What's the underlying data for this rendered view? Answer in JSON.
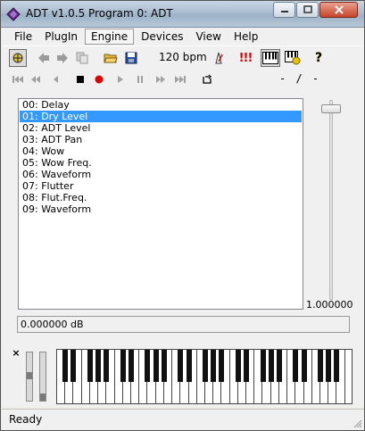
{
  "window": {
    "title": "ADT v1.0.5 Program 0: ADT"
  },
  "menu": [
    "File",
    "PlugIn",
    "Engine",
    "Devices",
    "View",
    "Help"
  ],
  "menu_active": "Engine",
  "toolbar": {
    "bpm": "120 bpm",
    "alert": "!!!",
    "help": "?"
  },
  "transport": {
    "time": "- / -"
  },
  "parameters": [
    "00: Delay",
    "01: Dry Level",
    "02: ADT Level",
    "03: ADT Pan",
    "04: Wow",
    "05: Wow Freq.",
    "06: Waveform",
    "07: Flutter",
    "08: Flut.Freq.",
    "09: Waveform"
  ],
  "selected_parameter": "01: Dry Level",
  "slider": {
    "value": "1.000000"
  },
  "value_field": "0.000000 dB",
  "keyboard": {
    "close_glyph": "×"
  },
  "status": "Ready",
  "colors": {
    "selection": "#3399ff",
    "record": "#e00000",
    "alert": "#e00000",
    "help": "#e6c200"
  }
}
